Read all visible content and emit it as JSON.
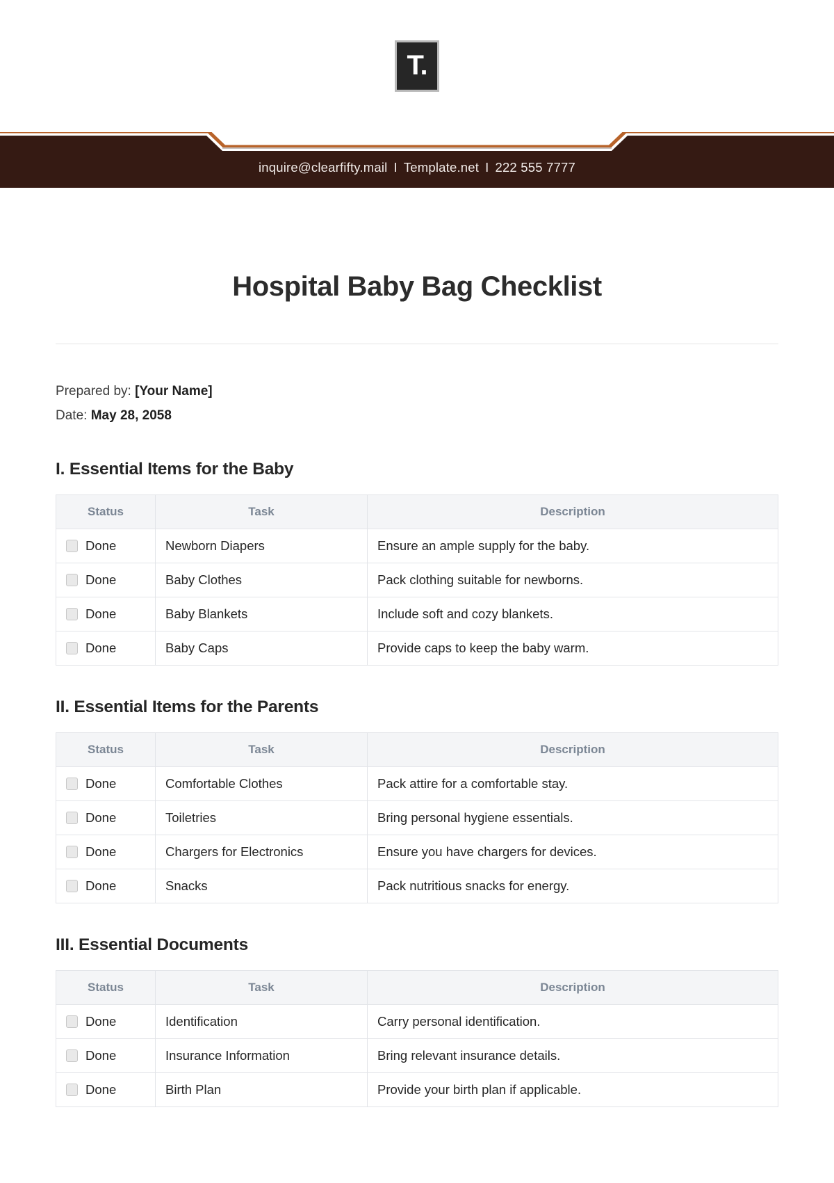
{
  "brand": {
    "logo_glyph": "T.",
    "logo_icon": "template-net-logo-icon"
  },
  "banner": {
    "email": "inquire@clearfifty.mail",
    "website": "Template.net",
    "phone": "222 555 7777",
    "separator": "I",
    "background_color": "#351a13",
    "accent_color": "#b8632a"
  },
  "document": {
    "title": "Hospital Baby Bag Checklist",
    "prepared_by_label": "Prepared by:",
    "prepared_by_value": "[Your Name]",
    "date_label": "Date:",
    "date_value": "May 28, 2058"
  },
  "table_headers": {
    "status": "Status",
    "task": "Task",
    "description": "Description"
  },
  "status_label": "Done",
  "sections": [
    {
      "heading": "I. Essential Items for the Baby",
      "rows": [
        {
          "status": "Done",
          "task": "Newborn Diapers",
          "description": "Ensure an ample supply for the baby."
        },
        {
          "status": "Done",
          "task": "Baby Clothes",
          "description": "Pack clothing suitable for newborns."
        },
        {
          "status": "Done",
          "task": "Baby Blankets",
          "description": "Include soft and cozy blankets."
        },
        {
          "status": "Done",
          "task": "Baby Caps",
          "description": "Provide caps to keep the baby warm."
        }
      ]
    },
    {
      "heading": "II. Essential Items for the Parents",
      "rows": [
        {
          "status": "Done",
          "task": "Comfortable Clothes",
          "description": "Pack attire for a comfortable stay."
        },
        {
          "status": "Done",
          "task": "Toiletries",
          "description": "Bring personal hygiene essentials."
        },
        {
          "status": "Done",
          "task": "Chargers for Electronics",
          "description": "Ensure you have chargers for devices."
        },
        {
          "status": "Done",
          "task": "Snacks",
          "description": "Pack nutritious snacks for energy."
        }
      ]
    },
    {
      "heading": "III. Essential Documents",
      "rows": [
        {
          "status": "Done",
          "task": "Identification",
          "description": "Carry personal identification."
        },
        {
          "status": "Done",
          "task": "Insurance Information",
          "description": "Bring relevant insurance details."
        },
        {
          "status": "Done",
          "task": "Birth Plan",
          "description": "Provide your birth plan if applicable."
        }
      ]
    }
  ]
}
